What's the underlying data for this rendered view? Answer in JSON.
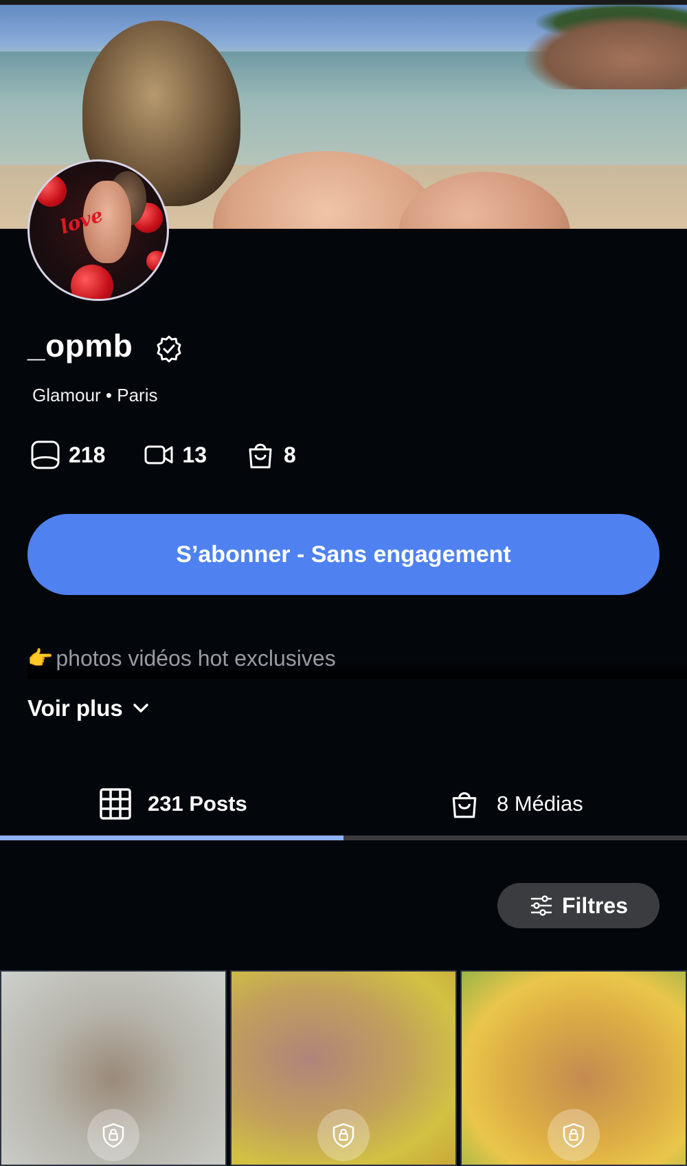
{
  "profile": {
    "username": "_opmb",
    "subtitle": "Glamour • Paris",
    "bio": "photos vidéos hot exclusives",
    "bio_emoji": "👉",
    "verified_icon": "verified-badge-icon"
  },
  "stats": {
    "photos": "218",
    "videos": "13",
    "medias": "8"
  },
  "subscribe": {
    "label": "S’abonner - Sans engagement"
  },
  "voir_plus": {
    "label": "Voir plus"
  },
  "tabs": [
    {
      "label": "231 Posts",
      "icon": "grid-icon",
      "active": true
    },
    {
      "label": "8 Médias",
      "icon": "shopping-bag-icon",
      "active": false
    }
  ],
  "filters": {
    "label": "Filtres",
    "icon": "sliders-icon"
  },
  "posts": [
    {
      "locked": true,
      "icon": "lock-shield-icon"
    },
    {
      "locked": true,
      "icon": "lock-shield-icon"
    },
    {
      "locked": true,
      "icon": "lock-shield-icon"
    }
  ],
  "colors": {
    "background": "#03060b",
    "accent": "#4f82f0",
    "tab_indicator": "#8fb3f7",
    "filters_bg": "#3b3c40"
  }
}
